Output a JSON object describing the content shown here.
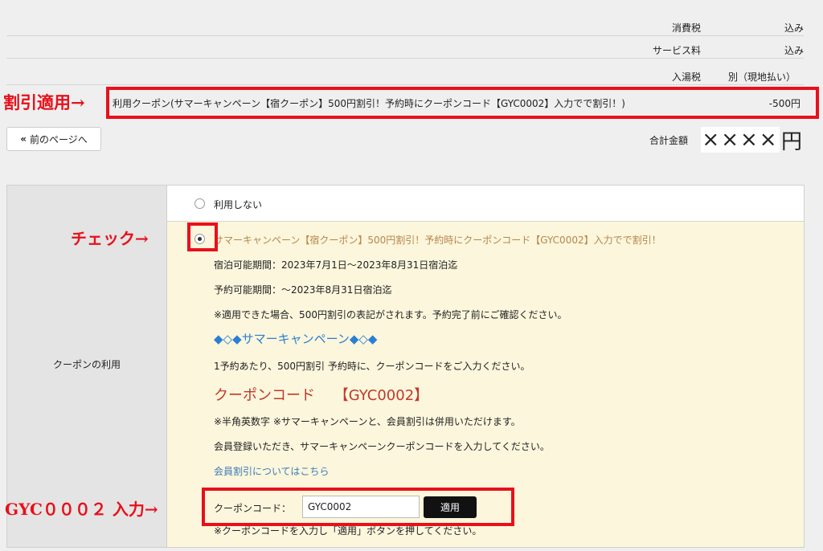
{
  "summary": {
    "tax_label": "消費税",
    "tax_value": "込み",
    "service_label": "サービス料",
    "service_value": "込み",
    "bath_label": "入湯税",
    "bath_value": "別（現地払い）",
    "coupon_line": "利用クーポン(サマーキャンペーン【宿クーポン】500円割引！予約時にクーポンコード【GYC0002】入力でで割引！)",
    "coupon_amount": "-500円"
  },
  "nav": {
    "prev_label": "前のページへ",
    "prev_icon": "double-chevron-left-icon"
  },
  "total": {
    "label": "合計金額",
    "value": "××××",
    "unit": "円"
  },
  "annotations": {
    "discount": "割引適用→",
    "check": "チェック→",
    "input": "GYC０００２ 入力→"
  },
  "coupon_section": {
    "left_label": "クーポンの利用",
    "none_option": "利用しない",
    "coupon_title": "サマーキャンペーン【宿クーポン】500円割引！予約時にクーポンコード【GYC0002】入力でで割引！",
    "stay_period": "宿泊可能期間：2023年7月1日〜2023年8月31日宿泊迄",
    "booking_period": "予約可能期間：〜2023年8月31日宿泊迄",
    "note": "※適用できた場合、500円割引の表記がされます。予約完了前にご確認ください。",
    "campaign_heading": "◆◇◆サマーキャンペーン◆◇◆",
    "per_booking": "1予約あたり、500円割引 予約時に、クーポンコードをご入力ください。",
    "code_heading": "クーポンコード　 【GYC0002】",
    "halfwidth_note": "※半角英数字 ※サマーキャンペーンと、会員割引は併用いただけます。",
    "member_note": "会員登録いただき、サマーキャンペーンクーポンコードを入力してください。",
    "member_link": "会員割引についてはこちら",
    "code_label": "クーポンコード：",
    "code_value": "GYC0002",
    "apply_label": "適用",
    "bottom_note": "※クーポンコードを入力し「適用」ボタンを押してください。"
  },
  "colors": {
    "annotation_red": "#e8101b",
    "accent_blue": "#2a7fd4",
    "code_red": "#c0392b",
    "title_brown": "#b8864a",
    "link_blue": "#3d7ab8"
  }
}
